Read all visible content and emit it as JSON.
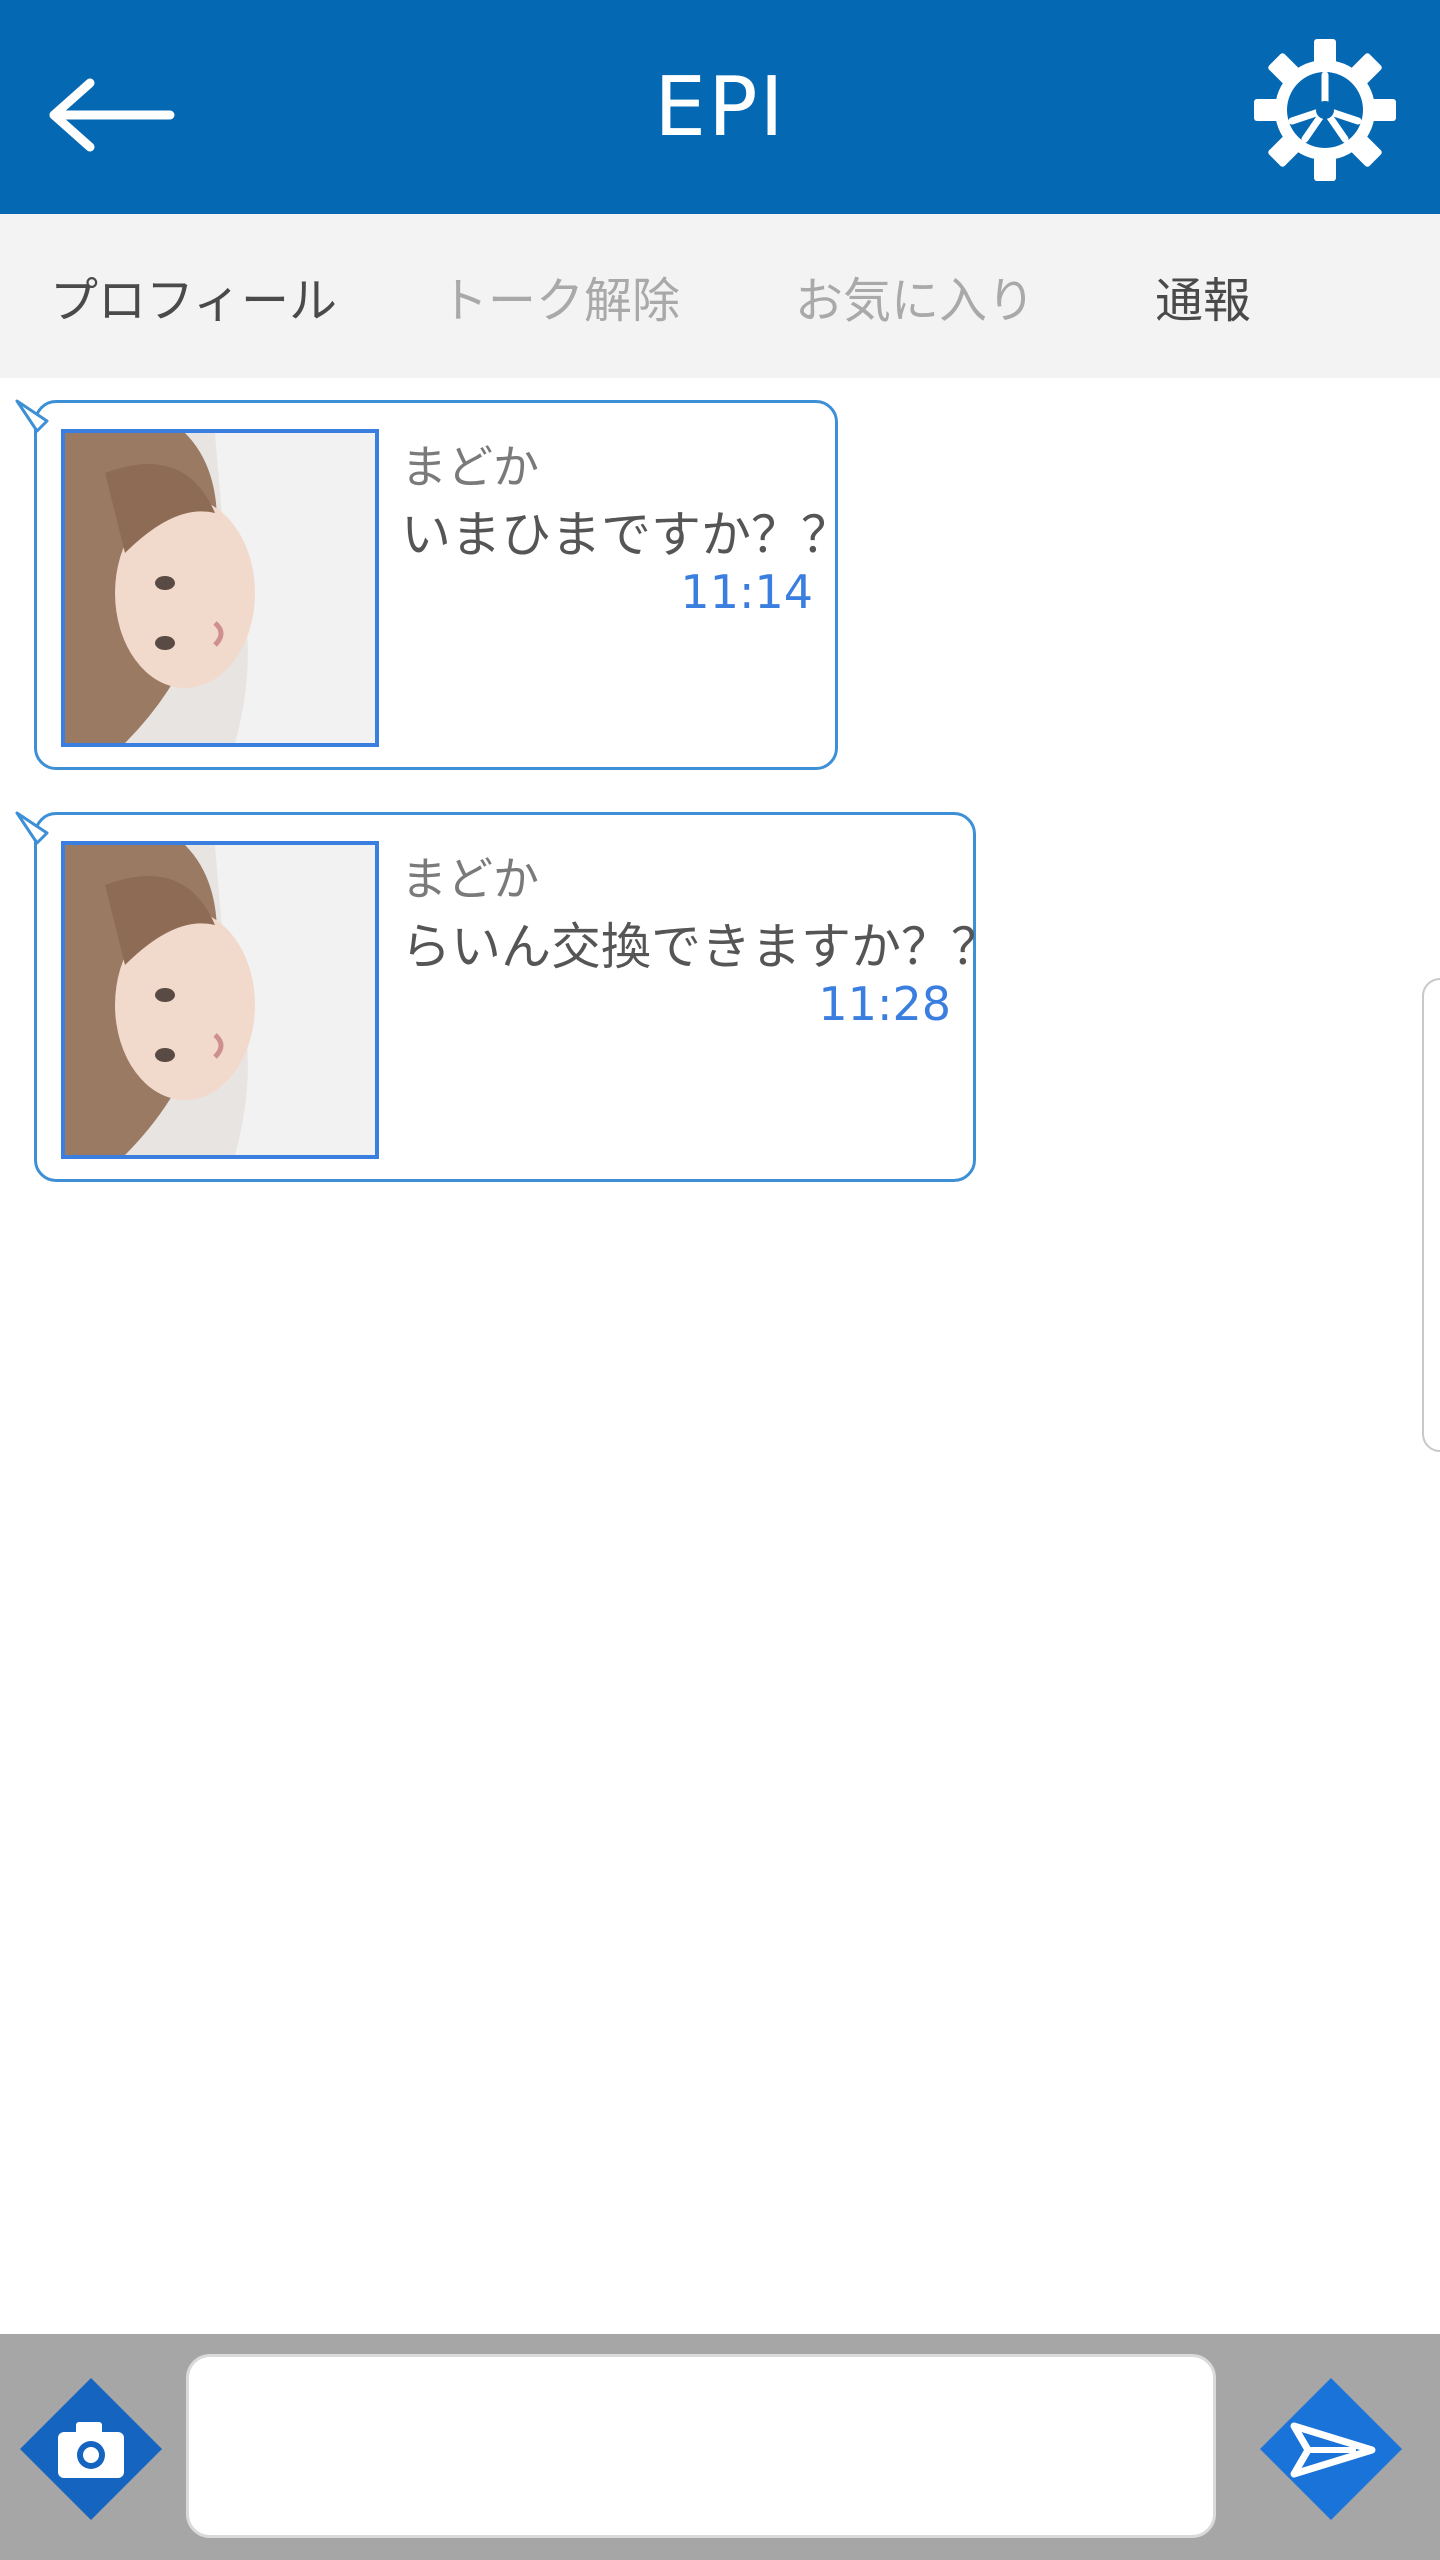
{
  "header": {
    "title": "EPI",
    "back_icon": "arrow-left-icon",
    "settings_icon": "gear-icon"
  },
  "tabs": [
    {
      "label": "プロフィール",
      "state": "active"
    },
    {
      "label": "トーク解除",
      "state": "inactive"
    },
    {
      "label": "お気に入り",
      "state": "inactive"
    },
    {
      "label": "通報",
      "state": "active"
    }
  ],
  "messages": [
    {
      "sender": "まどか",
      "text": "いまひまですか？？",
      "time": "11:14"
    },
    {
      "sender": "まどか",
      "text": "らいん交換できますか？？",
      "time": "11:28"
    }
  ],
  "composer": {
    "placeholder": "",
    "camera_icon": "camera-icon",
    "send_icon": "send-icon"
  },
  "colors": {
    "header_bg": "#0468b3",
    "accent": "#3a7ee0",
    "tabbar_bg": "#f3f3f3",
    "bottombar_bg": "#a6a6a6",
    "diamond_button": "#1565c0"
  }
}
